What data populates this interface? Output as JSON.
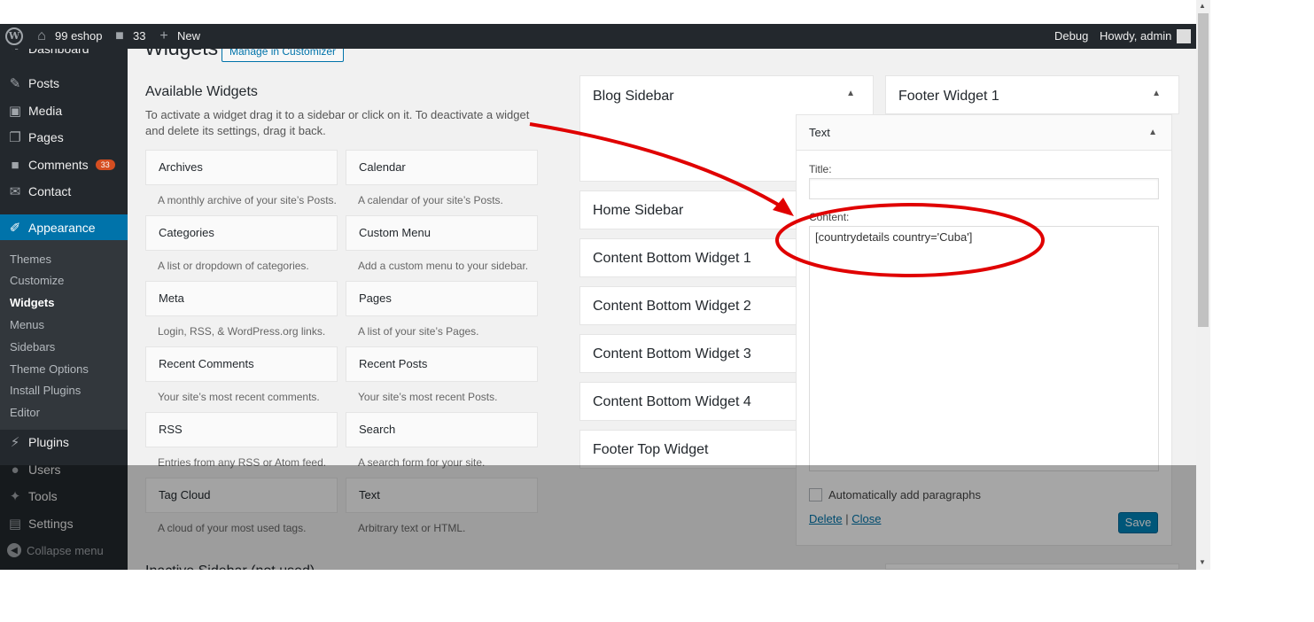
{
  "adminbar": {
    "site_name": "99 eshop",
    "comments_count": "33",
    "new_label": "New",
    "debug_label": "Debug",
    "howdy_label": "Howdy, admin"
  },
  "sidebar": {
    "dashboard": "Dashboard",
    "posts": "Posts",
    "media": "Media",
    "pages": "Pages",
    "comments": "Comments",
    "comments_badge": "33",
    "contact": "Contact",
    "appearance": "Appearance",
    "submenu": [
      "Themes",
      "Customize",
      "Widgets",
      "Menus",
      "Sidebars",
      "Theme Options",
      "Install Plugins",
      "Editor"
    ],
    "plugins": "Plugins",
    "users": "Users",
    "tools": "Tools",
    "settings": "Settings",
    "collapse": "Collapse menu"
  },
  "main": {
    "page_title": "Widgets",
    "customizer_button": "Manage in Customizer",
    "available_title": "Available Widgets",
    "available_desc": "To activate a widget drag it to a sidebar or click on it. To deactivate a widget and delete its settings, drag it back.",
    "widgets": [
      {
        "title": "Archives",
        "desc": "A monthly archive of your site’s Posts."
      },
      {
        "title": "Calendar",
        "desc": "A calendar of your site’s Posts."
      },
      {
        "title": "Categories",
        "desc": "A list or dropdown of categories."
      },
      {
        "title": "Custom Menu",
        "desc": "Add a custom menu to your sidebar."
      },
      {
        "title": "Meta",
        "desc": "Login, RSS, & WordPress.org links."
      },
      {
        "title": "Pages",
        "desc": "A list of your site’s Pages."
      },
      {
        "title": "Recent Comments",
        "desc": "Your site’s most recent comments."
      },
      {
        "title": "Recent Posts",
        "desc": "Your site’s most recent Posts."
      },
      {
        "title": "RSS",
        "desc": "Entries from any RSS or Atom feed."
      },
      {
        "title": "Search",
        "desc": "A search form for your site."
      },
      {
        "title": "Tag Cloud",
        "desc": "A cloud of your most used tags."
      },
      {
        "title": "Text",
        "desc": "Arbitrary text or HTML."
      }
    ],
    "cut_off_heading": "Inactive Sidebar (not used)"
  },
  "sidebars": {
    "blog": "Blog Sidebar",
    "home": "Home Sidebar",
    "content_bottom_1": "Content Bottom Widget 1",
    "content_bottom_2": "Content Bottom Widget 2",
    "content_bottom_3": "Content Bottom Widget 3",
    "content_bottom_4": "Content Bottom Widget 4",
    "footer_top": "Footer Top Widget",
    "footer_1": "Footer Widget 1"
  },
  "text_widget": {
    "header": "Text",
    "title_label": "Title:",
    "title_value": "",
    "content_label": "Content:",
    "content_value": "[countrydetails country='Cuba']",
    "autop_label": "Automatically add paragraphs",
    "delete_label": "Delete",
    "separator": "|",
    "close_label": "Close",
    "save_label": "Save"
  },
  "colors": {
    "adminbar_bg": "#23282d",
    "accent": "#0073aa",
    "save_button": "#0085ba",
    "annotation": "#e00000",
    "badge": "#d54e21"
  },
  "icons": {
    "wp": "wordpress-logo-icon",
    "home": "home-icon",
    "comment": "comment-bubble-icon",
    "plus": "plus-icon"
  }
}
